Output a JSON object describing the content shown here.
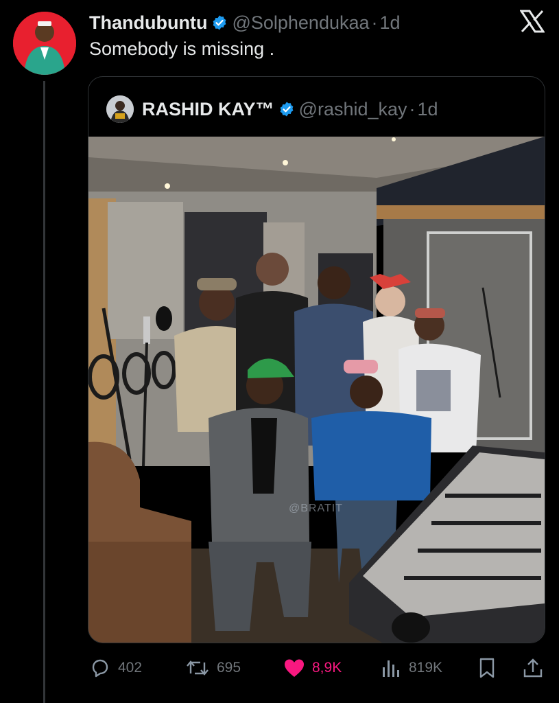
{
  "tweet": {
    "display_name": "Thandubuntu",
    "handle": "@Solphendukaa",
    "separator": "·",
    "time": "1d",
    "text": "Somebody is missing ."
  },
  "quote": {
    "display_name": "RASHID KAY™",
    "handle": "@rashid_kay",
    "separator": "·",
    "time": "1d",
    "watermark": "@BRATIT"
  },
  "actions": {
    "replies": "402",
    "reposts": "695",
    "likes": "8,9K",
    "views": "819K"
  },
  "colors": {
    "accent": "#1d9bf0",
    "like": "#f91880",
    "muted": "#71767b"
  },
  "icons": [
    "verified-badge-icon",
    "x-logo-icon",
    "reply-icon",
    "repost-icon",
    "heart-icon",
    "views-icon",
    "bookmark-icon",
    "share-icon"
  ]
}
